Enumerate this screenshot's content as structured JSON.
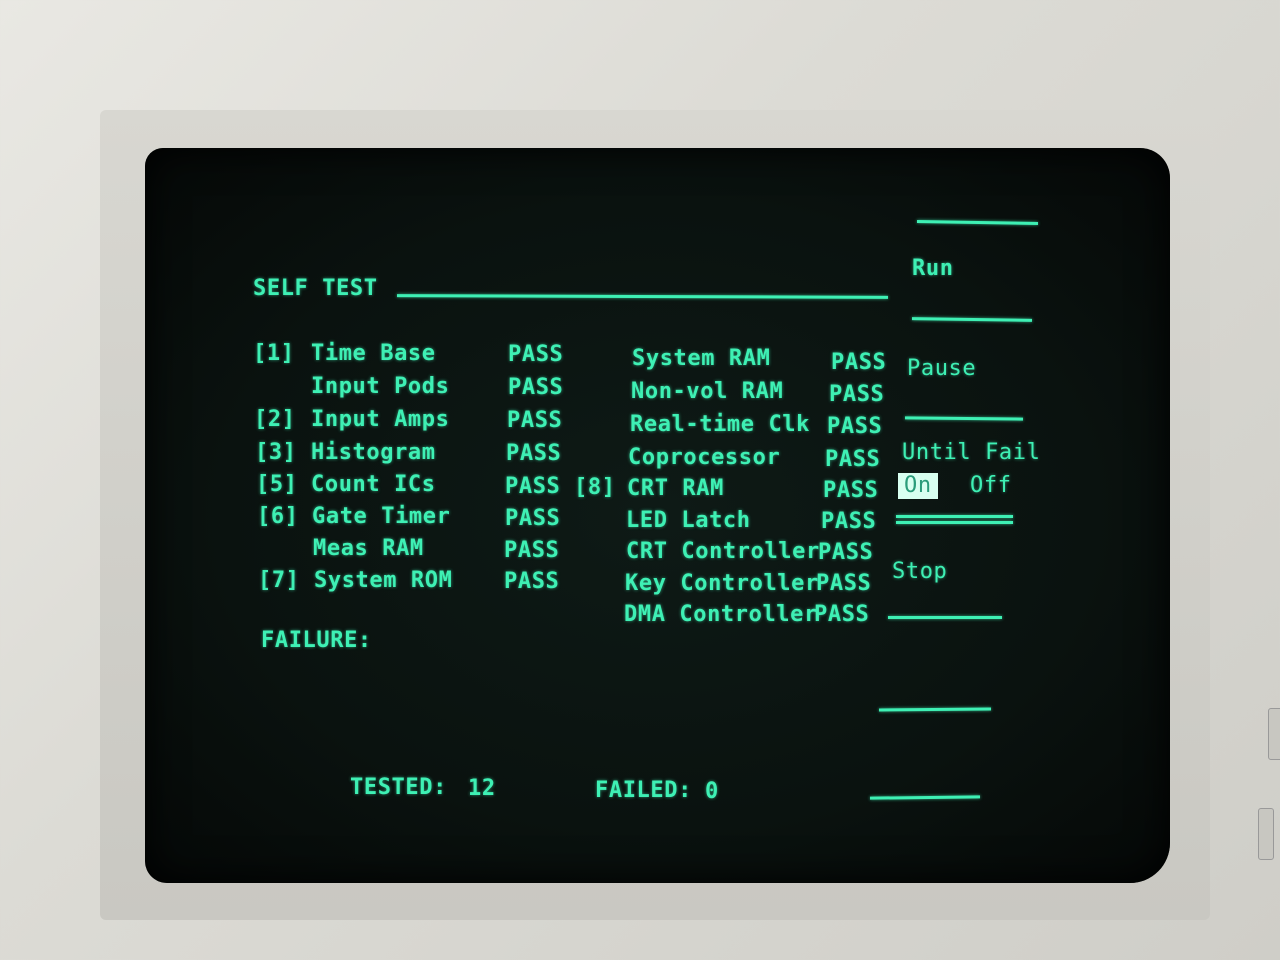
{
  "screen": {
    "title": "SELF TEST",
    "left_tests": [
      {
        "key": "[1]",
        "name": "Time Base",
        "result": "PASS"
      },
      {
        "key": "",
        "name": "Input Pods",
        "result": "PASS"
      },
      {
        "key": "[2]",
        "name": "Input Amps",
        "result": "PASS"
      },
      {
        "key": "[3]",
        "name": "Histogram",
        "result": "PASS"
      },
      {
        "key": "[5]",
        "name": "Count ICs",
        "result": "PASS"
      },
      {
        "key": "[6]",
        "name": "Gate Timer",
        "result": "PASS"
      },
      {
        "key": "",
        "name": "Meas RAM",
        "result": "PASS"
      },
      {
        "key": "[7]",
        "name": "System ROM",
        "result": "PASS"
      }
    ],
    "right_tests": [
      {
        "key": "",
        "name": "System RAM",
        "result": "PASS"
      },
      {
        "key": "",
        "name": "Non-vol RAM",
        "result": "PASS"
      },
      {
        "key": "",
        "name": "Real-time Clk",
        "result": "PASS"
      },
      {
        "key": "",
        "name": "Coprocessor",
        "result": "PASS"
      },
      {
        "key": "[8]",
        "name": "CRT RAM",
        "result": "PASS"
      },
      {
        "key": "",
        "name": "LED Latch",
        "result": "PASS"
      },
      {
        "key": "",
        "name": "CRT Controller",
        "result": "PASS"
      },
      {
        "key": "",
        "name": "Key Controller",
        "result": "PASS"
      },
      {
        "key": "",
        "name": "DMA Controller",
        "result": "PASS"
      }
    ],
    "failure_label": "FAILURE:",
    "tested_label": "TESTED:",
    "tested_value": "12",
    "failed_label": "FAILED:",
    "failed_value": "0"
  },
  "softkeys": {
    "run": "Run",
    "pause": "Pause",
    "until_fail": "Until Fail",
    "on": "On",
    "off": "Off",
    "until_fail_selected": "On",
    "stop": "Stop"
  },
  "colors": {
    "phosphor": "#3ef0b4",
    "screen": "#0a120f",
    "bezel": "#dcdbd5"
  }
}
